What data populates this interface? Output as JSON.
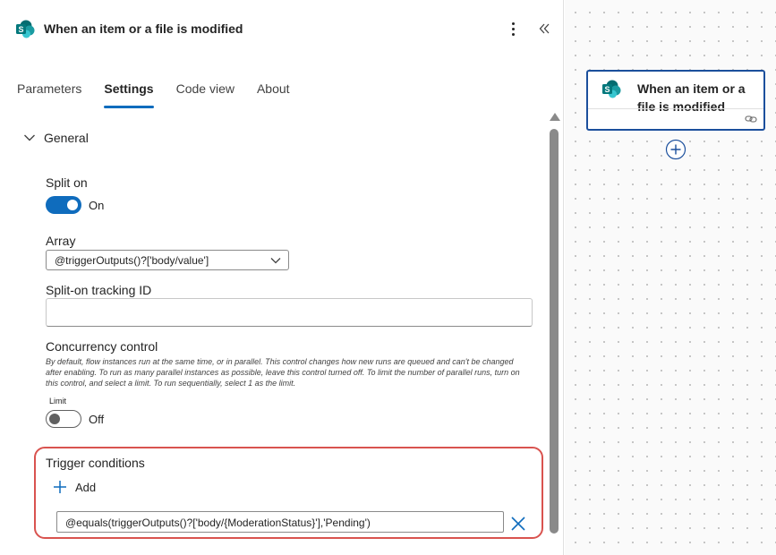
{
  "header": {
    "title": "When an item or a file is modified",
    "app_icon": "sharepoint-icon",
    "more_icon": "more-vertical-icon",
    "collapse_icon": "double-chevron-left-icon"
  },
  "tabs": [
    {
      "label": "Parameters",
      "active": false
    },
    {
      "label": "Settings",
      "active": true
    },
    {
      "label": "Code view",
      "active": false
    },
    {
      "label": "About",
      "active": false
    }
  ],
  "general": {
    "section_label": "General",
    "split_on": {
      "label": "Split on",
      "state": "On",
      "enabled": true
    },
    "array": {
      "label": "Array",
      "value": "@triggerOutputs()?['body/value']"
    },
    "tracking_id": {
      "label": "Split-on tracking ID",
      "value": ""
    },
    "concurrency": {
      "label": "Concurrency control",
      "description": "By default, flow instances run at the same time, or in parallel. This control changes how new runs are queued and can't be changed after enabling. To run as many parallel instances as possible, leave this control turned off. To limit the number of parallel runs, turn on this control, and select a limit. To run sequentially, select 1 as the limit.",
      "limit_label": "Limit",
      "state": "Off",
      "enabled": false
    },
    "trigger_conditions": {
      "label": "Trigger conditions",
      "add_label": "Add",
      "condition": "@equals(triggerOutputs()?['body/{ModerationStatus}'],'Pending')"
    }
  },
  "canvas": {
    "card_title": "When an item or a file is modified",
    "card_icon": "sharepoint-icon",
    "link_icon": "link-icon",
    "add_icon": "plus-circle-icon"
  },
  "colors": {
    "accent": "#0f6cbd",
    "card_border": "#1b4f9c",
    "highlight": "#d9534f",
    "sharepoint_dark": "#036c70",
    "sharepoint_mid": "#1a9ba1",
    "sharepoint_light": "#37c6d0"
  }
}
